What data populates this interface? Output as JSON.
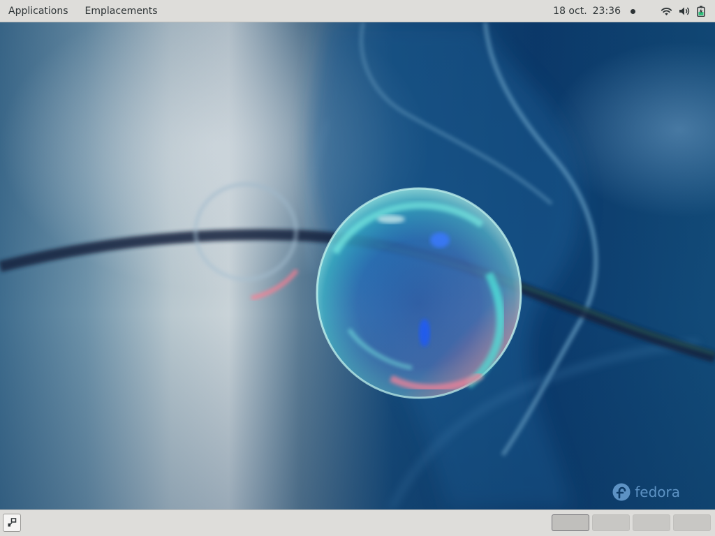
{
  "top_bar": {
    "menus": [
      {
        "label": "Applications"
      },
      {
        "label": "Emplacements"
      }
    ],
    "clock": {
      "date": "18 oct.",
      "time": "23:36"
    },
    "status_icons": [
      "notification-dot-icon",
      "wifi-icon",
      "volume-icon",
      "battery-charging-icon"
    ]
  },
  "desktop": {
    "wallpaper_logo_text": "fedora",
    "colors": {
      "deep_blue": "#0d3a66",
      "panel_bg": "#deddda",
      "bubble_cyan": "#3fe0d8",
      "bubble_pink": "#ff6b8a"
    }
  },
  "bottom_bar": {
    "show_desktop_icon": "show-desktop-icon",
    "workspaces": [
      {
        "active": true
      },
      {
        "active": false
      },
      {
        "active": false
      },
      {
        "active": false
      }
    ]
  }
}
